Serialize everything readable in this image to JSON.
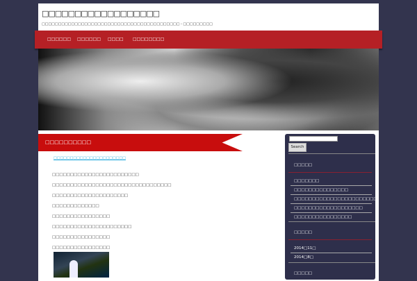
{
  "header": {
    "site_title": "□□□□□□□□□□□□□□□□□□",
    "tagline": "□□□□□□□□□□□□□□□□□□□□□□□□□□□□□□□□□□□□□□□□□□ - □□□□□□□□□"
  },
  "nav": {
    "items": [
      "□□□□□□",
      "□□□□□□",
      "□□□□",
      "□□□□□□□□"
    ]
  },
  "post": {
    "title": "□□□□□□□□□□",
    "link": "□□□□□□□□□□□□□□□□□□□□□□",
    "paragraphs": [
      "□□□□□□□□□□□□□□□□□□□□□□□□",
      "□□□□□□□□□□□□□□□□□□□□□□□□□□□□□□□□□",
      "□□□□□□□□□□□□□□□□□□□□□",
      "□□□□□□□□□□□□□",
      "□□□□□□□□□□□□□□□□",
      "□□□□□□□□□□□□□□□□□□□□□□",
      "□□□□□□□□□□□□□□□□",
      "□□□□□□□□□□□□□□□□"
    ]
  },
  "sidebar": {
    "search_button": "Search",
    "recent_heading": "□□□□□",
    "recent": [
      "□□□□□□□",
      "□□□□□□□□□□□□□□□",
      "□□□□□□□□□□□□□□□□□□□□□□□",
      "□□□□□□□□□□□□□□□□□□□",
      "□□□□□□□□□□□□□□□□"
    ],
    "archive_heading": "□□□□□",
    "archives": [
      "2014□11□",
      "2014□8□"
    ],
    "third_heading": "□□□□□"
  }
}
